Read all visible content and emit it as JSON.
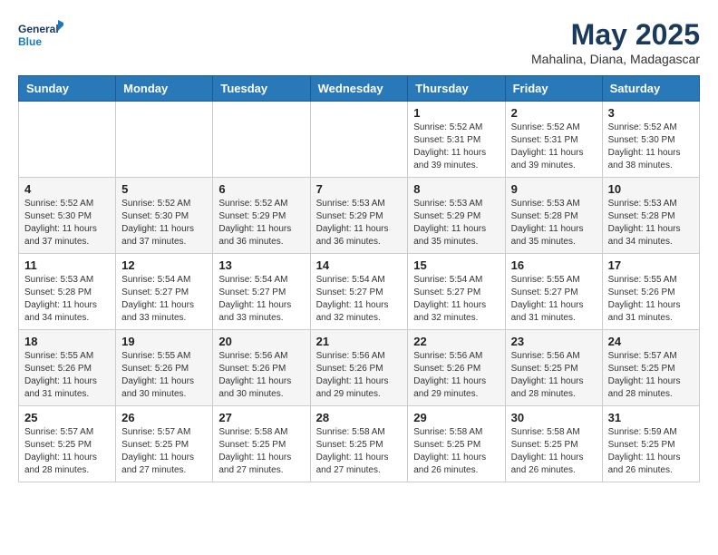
{
  "logo": {
    "line1": "General",
    "line2": "Blue"
  },
  "title": "May 2025",
  "subtitle": "Mahalina, Diana, Madagascar",
  "days_of_week": [
    "Sunday",
    "Monday",
    "Tuesday",
    "Wednesday",
    "Thursday",
    "Friday",
    "Saturday"
  ],
  "weeks": [
    [
      null,
      null,
      null,
      null,
      {
        "day": 1,
        "sunrise": "5:52 AM",
        "sunset": "5:31 PM",
        "daylight": "11 hours and 39 minutes."
      },
      {
        "day": 2,
        "sunrise": "5:52 AM",
        "sunset": "5:31 PM",
        "daylight": "11 hours and 39 minutes."
      },
      {
        "day": 3,
        "sunrise": "5:52 AM",
        "sunset": "5:30 PM",
        "daylight": "11 hours and 38 minutes."
      }
    ],
    [
      {
        "day": 4,
        "sunrise": "5:52 AM",
        "sunset": "5:30 PM",
        "daylight": "11 hours and 37 minutes."
      },
      {
        "day": 5,
        "sunrise": "5:52 AM",
        "sunset": "5:30 PM",
        "daylight": "11 hours and 37 minutes."
      },
      {
        "day": 6,
        "sunrise": "5:52 AM",
        "sunset": "5:29 PM",
        "daylight": "11 hours and 36 minutes."
      },
      {
        "day": 7,
        "sunrise": "5:53 AM",
        "sunset": "5:29 PM",
        "daylight": "11 hours and 36 minutes."
      },
      {
        "day": 8,
        "sunrise": "5:53 AM",
        "sunset": "5:29 PM",
        "daylight": "11 hours and 35 minutes."
      },
      {
        "day": 9,
        "sunrise": "5:53 AM",
        "sunset": "5:28 PM",
        "daylight": "11 hours and 35 minutes."
      },
      {
        "day": 10,
        "sunrise": "5:53 AM",
        "sunset": "5:28 PM",
        "daylight": "11 hours and 34 minutes."
      }
    ],
    [
      {
        "day": 11,
        "sunrise": "5:53 AM",
        "sunset": "5:28 PM",
        "daylight": "11 hours and 34 minutes."
      },
      {
        "day": 12,
        "sunrise": "5:54 AM",
        "sunset": "5:27 PM",
        "daylight": "11 hours and 33 minutes."
      },
      {
        "day": 13,
        "sunrise": "5:54 AM",
        "sunset": "5:27 PM",
        "daylight": "11 hours and 33 minutes."
      },
      {
        "day": 14,
        "sunrise": "5:54 AM",
        "sunset": "5:27 PM",
        "daylight": "11 hours and 32 minutes."
      },
      {
        "day": 15,
        "sunrise": "5:54 AM",
        "sunset": "5:27 PM",
        "daylight": "11 hours and 32 minutes."
      },
      {
        "day": 16,
        "sunrise": "5:55 AM",
        "sunset": "5:27 PM",
        "daylight": "11 hours and 31 minutes."
      },
      {
        "day": 17,
        "sunrise": "5:55 AM",
        "sunset": "5:26 PM",
        "daylight": "11 hours and 31 minutes."
      }
    ],
    [
      {
        "day": 18,
        "sunrise": "5:55 AM",
        "sunset": "5:26 PM",
        "daylight": "11 hours and 31 minutes."
      },
      {
        "day": 19,
        "sunrise": "5:55 AM",
        "sunset": "5:26 PM",
        "daylight": "11 hours and 30 minutes."
      },
      {
        "day": 20,
        "sunrise": "5:56 AM",
        "sunset": "5:26 PM",
        "daylight": "11 hours and 30 minutes."
      },
      {
        "day": 21,
        "sunrise": "5:56 AM",
        "sunset": "5:26 PM",
        "daylight": "11 hours and 29 minutes."
      },
      {
        "day": 22,
        "sunrise": "5:56 AM",
        "sunset": "5:26 PM",
        "daylight": "11 hours and 29 minutes."
      },
      {
        "day": 23,
        "sunrise": "5:56 AM",
        "sunset": "5:25 PM",
        "daylight": "11 hours and 28 minutes."
      },
      {
        "day": 24,
        "sunrise": "5:57 AM",
        "sunset": "5:25 PM",
        "daylight": "11 hours and 28 minutes."
      }
    ],
    [
      {
        "day": 25,
        "sunrise": "5:57 AM",
        "sunset": "5:25 PM",
        "daylight": "11 hours and 28 minutes."
      },
      {
        "day": 26,
        "sunrise": "5:57 AM",
        "sunset": "5:25 PM",
        "daylight": "11 hours and 27 minutes."
      },
      {
        "day": 27,
        "sunrise": "5:58 AM",
        "sunset": "5:25 PM",
        "daylight": "11 hours and 27 minutes."
      },
      {
        "day": 28,
        "sunrise": "5:58 AM",
        "sunset": "5:25 PM",
        "daylight": "11 hours and 27 minutes."
      },
      {
        "day": 29,
        "sunrise": "5:58 AM",
        "sunset": "5:25 PM",
        "daylight": "11 hours and 26 minutes."
      },
      {
        "day": 30,
        "sunrise": "5:58 AM",
        "sunset": "5:25 PM",
        "daylight": "11 hours and 26 minutes."
      },
      {
        "day": 31,
        "sunrise": "5:59 AM",
        "sunset": "5:25 PM",
        "daylight": "11 hours and 26 minutes."
      }
    ]
  ]
}
